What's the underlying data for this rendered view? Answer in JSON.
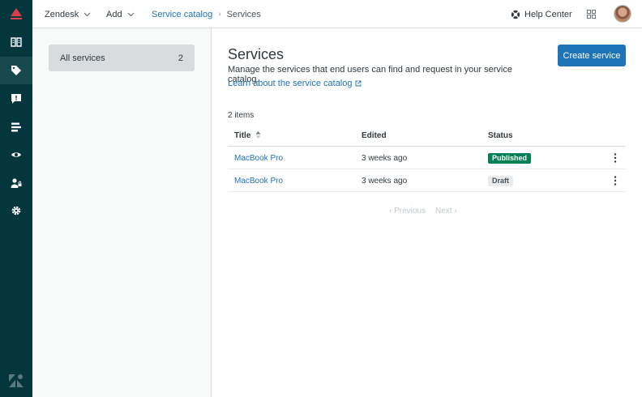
{
  "topbar": {
    "product_menu": "Zendesk",
    "add_menu": "Add",
    "breadcrumb_link": "Service catalog",
    "breadcrumb_separator": "›",
    "breadcrumb_current": "Services",
    "help_center": "Help Center"
  },
  "sidepanel": {
    "item_label": "All services",
    "item_count": "2"
  },
  "main": {
    "title": "Services",
    "description": "Manage the services that end users can find and request in your service catalog.",
    "learn_link": "Learn about the service catalog",
    "create_button": "Create service",
    "item_count": "2 items"
  },
  "table": {
    "headers": {
      "title": "Title",
      "edited": "Edited",
      "status": "Status"
    },
    "rows": [
      {
        "title": "MacBook Pro",
        "edited": "3 weeks ago",
        "status": "Published"
      },
      {
        "title": "MacBook Pro",
        "edited": "3 weeks ago",
        "status": "Draft"
      }
    ]
  },
  "pagination": {
    "previous": "Previous",
    "next": "Next"
  },
  "colors": {
    "rail": "#03363d",
    "accent": "#1f73b7",
    "published": "#038153",
    "logo_red": "#d93f4c"
  }
}
